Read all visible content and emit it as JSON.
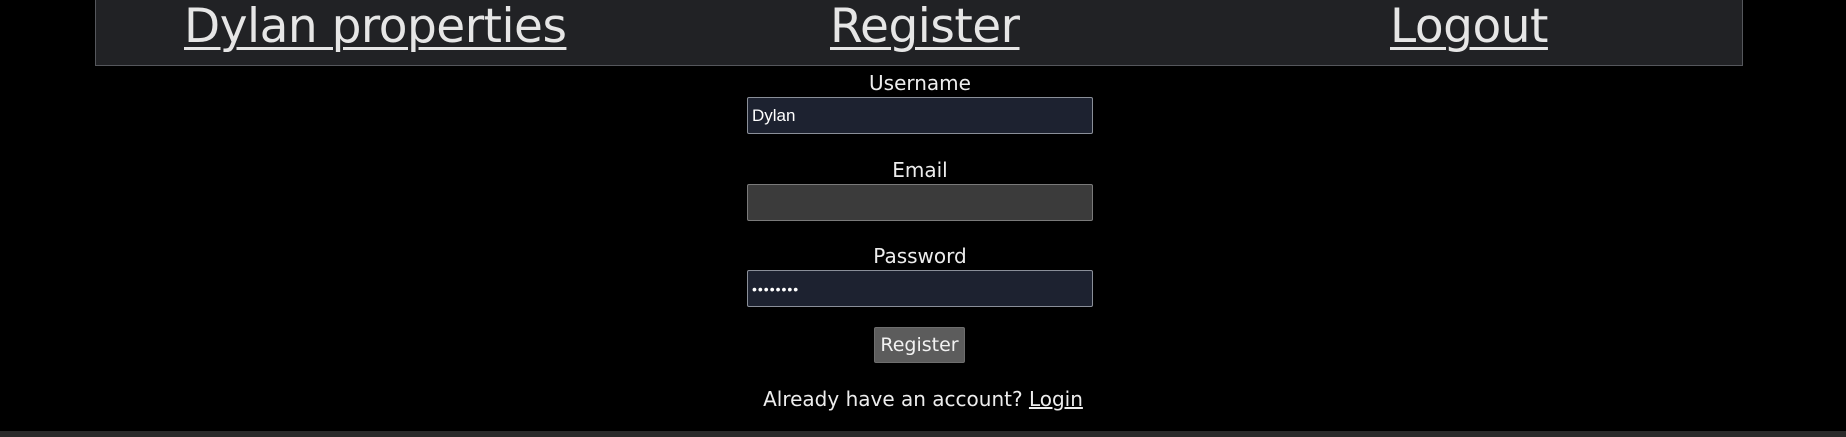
{
  "nav": {
    "brand": "Dylan properties",
    "register": "Register",
    "logout": "Logout"
  },
  "form": {
    "username_label": "Username",
    "username_value": "Dylan",
    "email_label": "Email",
    "email_value": "",
    "password_label": "Password",
    "password_value": "password",
    "submit_label": "Register"
  },
  "footer": {
    "prompt": "Already have an account?",
    "login_link": "Login"
  },
  "colors": {
    "background": "#000000",
    "navbar": "#212225",
    "input_filled": "#1d2230",
    "input_empty": "#3b3b3b",
    "button": "#5c5c5c",
    "text": "#e6e6e6"
  }
}
